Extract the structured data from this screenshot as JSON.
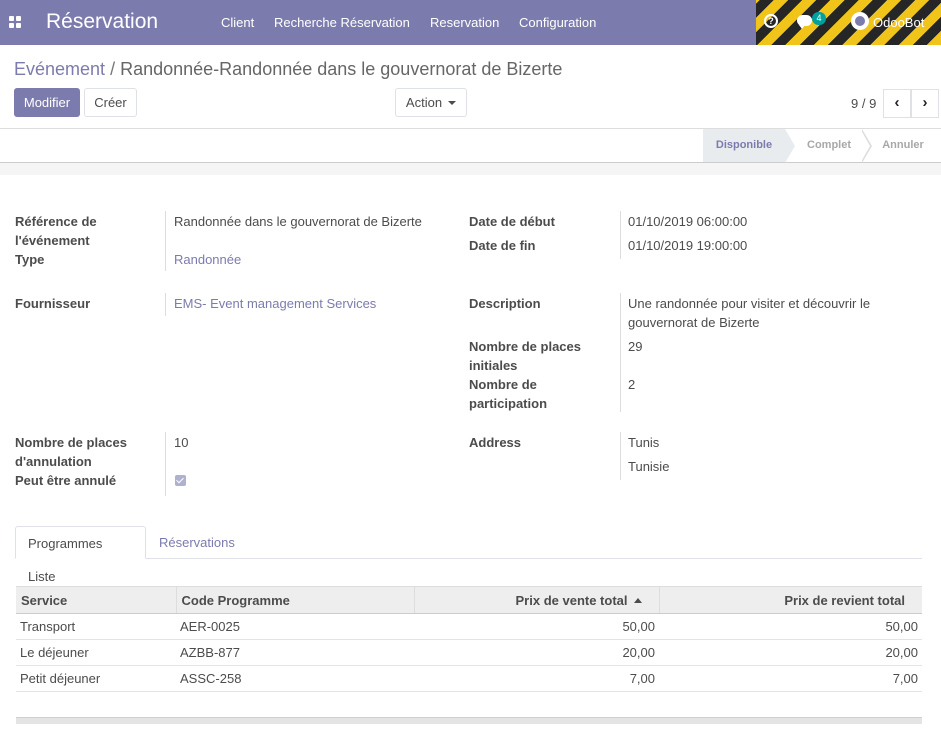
{
  "navbar": {
    "app_title": "Réservation",
    "menu": [
      "Client",
      "Recherche Réservation",
      "Reservation",
      "Configuration"
    ],
    "help_icon": "question-circle-icon",
    "chat_icon": "comments-icon",
    "chat_badge": "4",
    "user_name": "OdooBot",
    "bar_color": "#7c7bad"
  },
  "breadcrumb": {
    "parent": "Evénement",
    "separator": "/",
    "current": "Randonnée-Randonnée dans le gouvernorat de Bizerte"
  },
  "buttons": {
    "edit": "Modifier",
    "create": "Créer",
    "action": "Action"
  },
  "pager": {
    "value": "9 / 9",
    "prev_icon": "chevron-left-icon",
    "next_icon": "chevron-right-icon"
  },
  "statusbar": {
    "states": [
      "Disponible",
      "Complet",
      "Annuler"
    ],
    "active": "Disponible"
  },
  "form": {
    "ref_label_1": "Référence de",
    "ref_label_2": "l'événement",
    "ref_value": "Randonnée dans le gouvernorat de Bizerte",
    "type_label": "Type",
    "type_value": "Randonnée",
    "supplier_label": "Fournisseur",
    "supplier_value": "EMS- Event management Services",
    "start_label": "Date de début",
    "start_value": "01/10/2019 06:00:00",
    "end_label": "Date de fin",
    "end_value": "01/10/2019 19:00:00",
    "desc_label": "Description",
    "desc_value_1": "Une randonnée pour visiter et découvrir le",
    "desc_value_2": "gouvernorat de Bizerte",
    "seats_label_1": "Nombre de places",
    "seats_label_2": "initiales",
    "seats_value": "29",
    "part_label_1": "Nombre de",
    "part_label_2": "participation",
    "part_value": "2",
    "cancel_seats_label_1": "Nombre de places",
    "cancel_seats_label_2": "d'annulation",
    "cancel_seats_value": "10",
    "cancellable_label": "Peut être annulé",
    "cancellable_checked": true,
    "address_label": "Address",
    "address_city": "Tunis",
    "address_country": "Tunisie"
  },
  "tabs": {
    "programmes": "Programmes Liste",
    "reservations": "Réservations",
    "active": "Programmes Liste"
  },
  "table": {
    "headers": [
      "Service",
      "Code Programme",
      "Prix de vente total",
      "Prix de revient total"
    ],
    "sorted_column": "Prix de vente total",
    "rows": [
      [
        "Transport",
        "AER-0025",
        "50,00",
        "50,00"
      ],
      [
        "Le déjeuner",
        "AZBB-877",
        "20,00",
        "20,00"
      ],
      [
        "Petit déjeuner",
        "ASSC-258",
        "7,00",
        "7,00"
      ]
    ]
  }
}
